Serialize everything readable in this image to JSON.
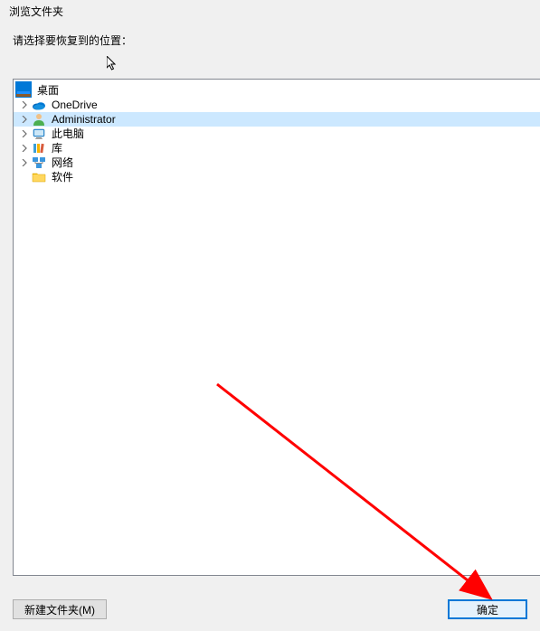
{
  "title": "浏览文件夹",
  "prompt": "请选择要恢复到的位置：",
  "tree": {
    "root": {
      "label": "桌面",
      "icon": "desktop"
    },
    "items": [
      {
        "label": "OneDrive",
        "icon": "onedrive",
        "expandable": true,
        "selected": false
      },
      {
        "label": "Administrator",
        "icon": "user",
        "expandable": true,
        "selected": true
      },
      {
        "label": "此电脑",
        "icon": "thispc",
        "expandable": true,
        "selected": false
      },
      {
        "label": "库",
        "icon": "libraries",
        "expandable": true,
        "selected": false
      },
      {
        "label": "网络",
        "icon": "network",
        "expandable": true,
        "selected": false
      },
      {
        "label": "软件",
        "icon": "folder",
        "expandable": false,
        "selected": false
      }
    ]
  },
  "buttons": {
    "new_folder": "新建文件夹(M)",
    "ok": "确定"
  },
  "annotation": {
    "arrow_color": "#ff0000"
  }
}
